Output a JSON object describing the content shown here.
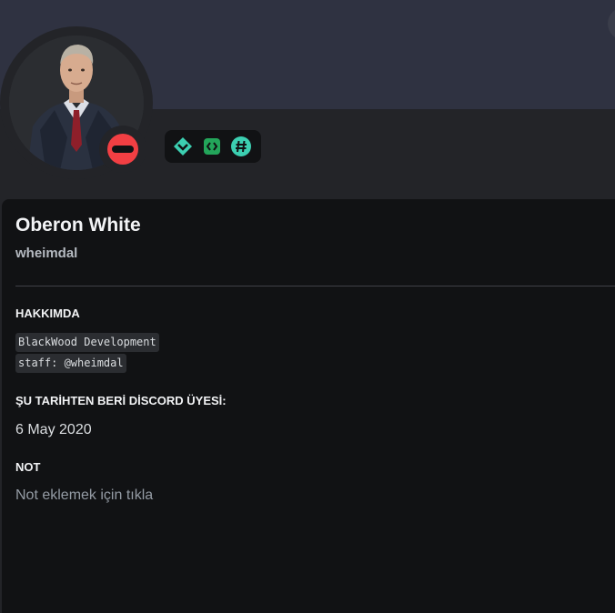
{
  "profile": {
    "display_name": "Oberon White",
    "username": "wheimdal",
    "status": "do-not-disturb",
    "avatar": "avatar-man-in-suit"
  },
  "badges": [
    {
      "icon": "hypesquad-badge-icon",
      "color": "#3ccfb1"
    },
    {
      "icon": "active-developer-badge-icon",
      "color": "#23a55a"
    },
    {
      "icon": "hash-quest-badge-icon",
      "color": "#3ccfb1"
    }
  ],
  "about": {
    "title": "HAKKIMDA",
    "line1": "BlackWood Development",
    "line2": "staff: @wheimdal"
  },
  "member_since": {
    "title": "ŞU TARİHTEN BERİ DİSCORD ÜYESİ:",
    "date": "6 May 2020"
  },
  "note": {
    "title": "NOT",
    "placeholder": "Not eklemek için tıkla"
  },
  "colors": {
    "banner": "#2f3241",
    "card": "#111214",
    "status_dnd": "#f23f43"
  }
}
